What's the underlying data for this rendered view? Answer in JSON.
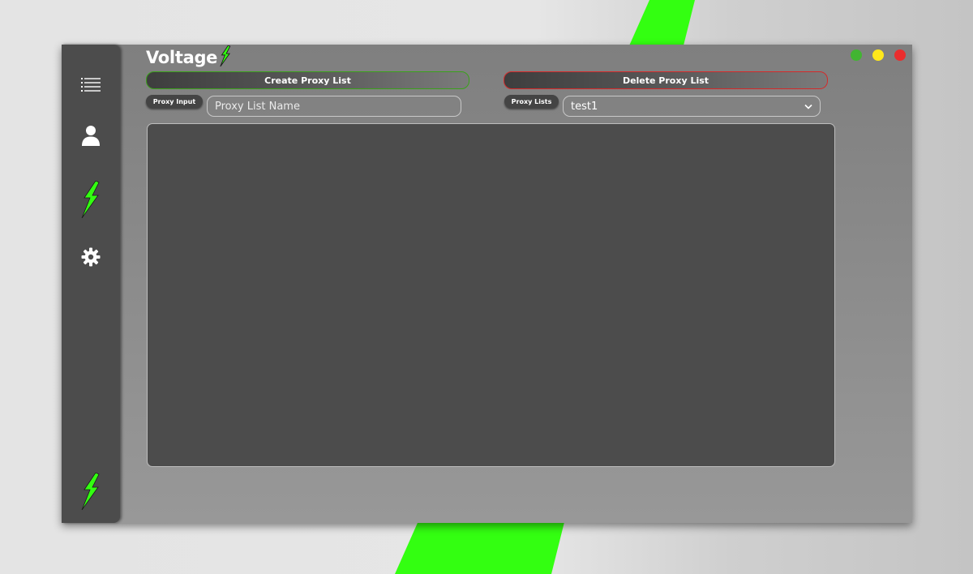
{
  "app": {
    "title": "Voltage"
  },
  "colors": {
    "accent": "#33ff11",
    "create_border": "#3aa11a",
    "delete_border": "#d42a2a",
    "dot_green": "#42b532",
    "dot_yellow": "#ffe81a",
    "dot_red": "#ea2d2d"
  },
  "sidebar": {
    "items": [
      {
        "icon": "list-icon"
      },
      {
        "icon": "user-icon"
      },
      {
        "icon": "lightning-icon"
      },
      {
        "icon": "gear-icon"
      }
    ],
    "logo_icon": "lightning-logo-icon"
  },
  "toolbar": {
    "create_label": "Create Proxy List",
    "delete_label": "Delete Proxy List"
  },
  "proxy_input": {
    "tag": "Proxy Input",
    "placeholder": "Proxy List Name",
    "value": ""
  },
  "proxy_lists": {
    "tag": "Proxy Lists",
    "selected": "test1"
  },
  "editor": {
    "content": ""
  }
}
